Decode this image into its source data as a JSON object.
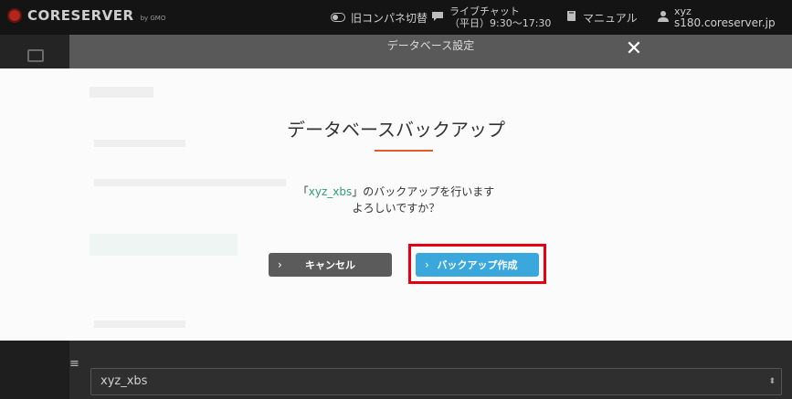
{
  "header": {
    "logo_text": "CORESERVER",
    "logo_sub": "by GMO",
    "old_panel_label": "旧コンパネ切替",
    "chat_label": "ライブチャット",
    "chat_hours": "（平日）9:30～17:30",
    "manual_label": "マニュアル",
    "user_name": "xyz",
    "user_host": "s180.coreserver.jp"
  },
  "page": {
    "title": "データベース設定",
    "close_symbol": "✕",
    "db_select_value": "xyz_xbs",
    "select_arrow": "⬍"
  },
  "modal": {
    "title": "データベースバックアップ",
    "msg_prefix": "「",
    "db_name": "xyz_xbs",
    "msg_suffix": "」のバックアップを行います",
    "msg_line2": "よろしいですか？",
    "cancel_label": "キャンセル",
    "create_label": "バックアップ作成",
    "chevron": "›"
  },
  "colors": {
    "accent_orange": "#e4592e",
    "button_blue": "#3aa8dc",
    "highlight_red": "#e60012",
    "db_name_green": "#2f9c7a"
  },
  "icons": {
    "toggle": "toggle-icon",
    "chat": "chat-bubble-icon",
    "manual": "book-icon",
    "user": "user-icon",
    "close": "close-icon",
    "menu": "hamburger-icon"
  }
}
